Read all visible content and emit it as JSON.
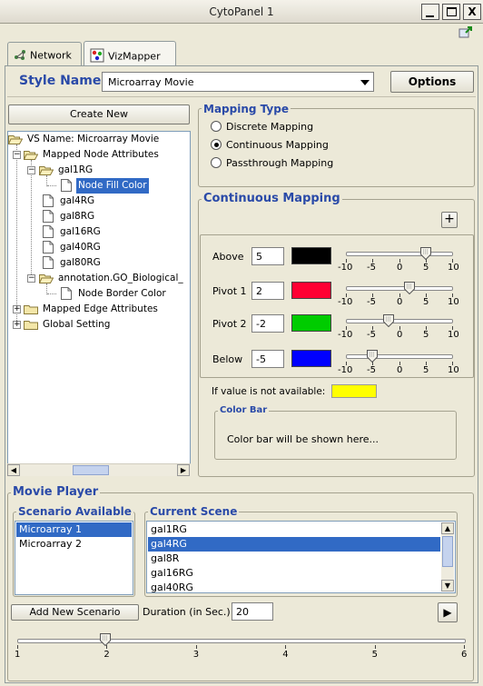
{
  "window": {
    "title": "CytoPanel 1",
    "buttons": {
      "minimize": "_",
      "maximize": "□",
      "close": "X"
    }
  },
  "tabs": [
    {
      "label": "Network",
      "icon": "network-icon",
      "selected": false
    },
    {
      "label": "VizMapper",
      "icon": "vizmapper-icon",
      "selected": true
    }
  ],
  "style": {
    "label": "Style Name",
    "value": "Microarray Movie",
    "options_button": "Options"
  },
  "left": {
    "create_new": "Create New",
    "tree": {
      "root": "VS Name: Microarray Movie",
      "mapped_node": "Mapped Node Attributes",
      "gal1rg": "gal1RG",
      "node_fill_color": "Node Fill Color",
      "gal4rg": "gal4RG",
      "gal8rg": "gal8RG",
      "gal16rg": "gal16RG",
      "gal40rg": "gal40RG",
      "gal80rg": "gal80RG",
      "annotation": "annotation.GO_Biological_",
      "node_border_color": "Node Border Color",
      "mapped_edge": "Mapped Edge Attributes",
      "global": "Global Setting"
    }
  },
  "mapping_type": {
    "title": "Mapping Type",
    "options": [
      "Discrete Mapping",
      "Continuous Mapping",
      "Passthrough Mapping"
    ],
    "selected_index": 1
  },
  "continuous": {
    "title": "Continuous Mapping",
    "add_button": "+",
    "rows": [
      {
        "label": "Above",
        "value": "5",
        "color": "#000000",
        "slider_value": 5
      },
      {
        "label": "Pivot 1",
        "value": "2",
        "color": "#ff0033",
        "slider_value": 2
      },
      {
        "label": "Pivot 2",
        "value": "-2",
        "color": "#00cc00",
        "slider_value": -2
      },
      {
        "label": "Below",
        "value": "-5",
        "color": "#0000ff",
        "slider_value": -5
      }
    ],
    "ticks": [
      "-10",
      "-5",
      "0",
      "5",
      "10"
    ],
    "slider_min": -10,
    "slider_max": 10,
    "na_label": "If value is not available:",
    "na_color": "#ffff00",
    "color_bar_title": "Color Bar",
    "color_bar_text": "Color bar will be shown here..."
  },
  "movie": {
    "title": "Movie Player",
    "scenario_title": "Scenario Available",
    "scenarios": [
      "Microarray 1",
      "Microarray 2"
    ],
    "scenario_selected": 0,
    "scene_title": "Current Scene",
    "scenes": [
      "gal1RG",
      "gal4RG",
      "gal8R",
      "gal16RG",
      "gal40RG"
    ],
    "scene_selected": 1,
    "add_scenario": "Add New Scenario",
    "duration_label": "Duration (in Sec.)",
    "duration_value": "20",
    "play_icon": "▶",
    "slider_ticks": [
      "1",
      "2",
      "3",
      "4",
      "5",
      "6"
    ],
    "slider_value": 2
  }
}
